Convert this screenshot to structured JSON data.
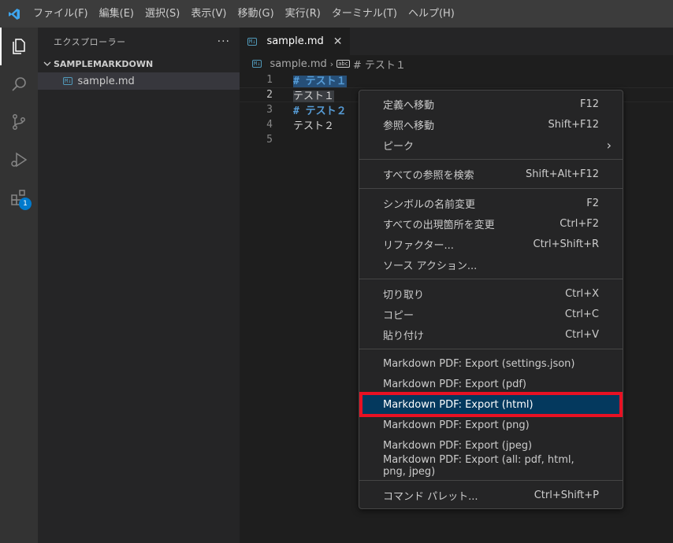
{
  "menubar": {
    "items": [
      "ファイル(F)",
      "編集(E)",
      "選択(S)",
      "表示(V)",
      "移動(G)",
      "実行(R)",
      "ターミナル(T)",
      "ヘルプ(H)"
    ]
  },
  "activity": {
    "extensions_badge": "1"
  },
  "sidebar": {
    "title": "エクスプローラー",
    "more": "···",
    "folder": "SAMPLEMARKDOWN",
    "file": "sample.md",
    "file_icon": "M↓"
  },
  "editor": {
    "tab_label": "sample.md",
    "tab_close": "✕",
    "breadcrumb_file": "sample.md",
    "breadcrumb_symbol": "# テスト１",
    "symbol_icon": "abc",
    "lines": [
      {
        "num": "1",
        "text": "# テスト１"
      },
      {
        "num": "2",
        "text": "テスト１"
      },
      {
        "num": "3",
        "text": "# テスト２"
      },
      {
        "num": "4",
        "text": "テスト２"
      },
      {
        "num": "5",
        "text": ""
      }
    ]
  },
  "context_menu": {
    "groups": [
      [
        {
          "label": "定義へ移動",
          "key": "F12"
        },
        {
          "label": "参照へ移動",
          "key": "Shift+F12"
        },
        {
          "label": "ピーク",
          "key": "›"
        }
      ],
      [
        {
          "label": "すべての参照を検索",
          "key": "Shift+Alt+F12"
        }
      ],
      [
        {
          "label": "シンボルの名前変更",
          "key": "F2"
        },
        {
          "label": "すべての出現箇所を変更",
          "key": "Ctrl+F2"
        },
        {
          "label": "リファクター...",
          "key": "Ctrl+Shift+R"
        },
        {
          "label": "ソース アクション...",
          "key": ""
        }
      ],
      [
        {
          "label": "切り取り",
          "key": "Ctrl+X"
        },
        {
          "label": "コピー",
          "key": "Ctrl+C"
        },
        {
          "label": "貼り付け",
          "key": "Ctrl+V"
        }
      ],
      [
        {
          "label": "Markdown PDF: Export (settings.json)",
          "key": ""
        },
        {
          "label": "Markdown PDF: Export (pdf)",
          "key": ""
        },
        {
          "label": "Markdown PDF: Export (html)",
          "key": ""
        },
        {
          "label": "Markdown PDF: Export (png)",
          "key": ""
        },
        {
          "label": "Markdown PDF: Export (jpeg)",
          "key": ""
        },
        {
          "label": "Markdown PDF: Export (all: pdf, html, png, jpeg)",
          "key": ""
        }
      ],
      [
        {
          "label": "コマンド パレット...",
          "key": "Ctrl+Shift+P"
        }
      ]
    ]
  },
  "colors": {
    "accent": "#007acc",
    "highlight_border": "#e81123",
    "selected_item": "#04395e"
  }
}
